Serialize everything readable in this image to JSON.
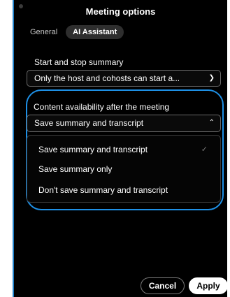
{
  "window": {
    "title": "Meeting options"
  },
  "tabs": [
    {
      "label": "General",
      "active": false
    },
    {
      "label": "AI Assistant",
      "active": true
    }
  ],
  "start_stop": {
    "label": "Start and stop summary",
    "value": "Only the host and cohosts can start a..."
  },
  "availability": {
    "label": "Content availability after the meeting",
    "value": "Save summary and transcript",
    "options": [
      {
        "label": "Save summary and transcript",
        "selected": true
      },
      {
        "label": "Save summary only",
        "selected": false
      },
      {
        "label": "Don't save summary and transcript",
        "selected": false
      }
    ]
  },
  "footer": {
    "cancel_label": "Cancel",
    "apply_label": "Apply"
  },
  "colors": {
    "accent": "#1e90e6",
    "background": "#000000"
  },
  "icons": {
    "chevron_down": "chevron-down-icon",
    "chevron_up": "chevron-up-icon",
    "checkmark": "checkmark-icon"
  }
}
